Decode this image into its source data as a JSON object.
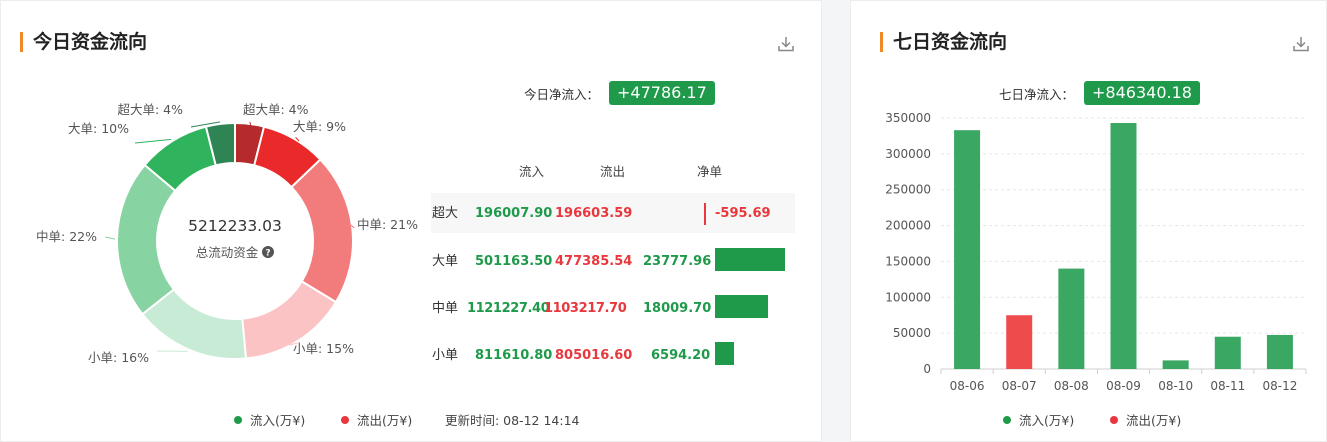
{
  "today": {
    "title": "今日资金流向",
    "net_label": "今日净流入：",
    "net_value": "+47786.17",
    "center_value": "5212233.03",
    "center_label": "总流动资金",
    "table_headers": {
      "inflow": "流入",
      "outflow": "流出",
      "net": "净单"
    },
    "rows": [
      {
        "cat": "超大",
        "inflow": "196007.90",
        "outflow": "196603.59",
        "net": "-595.69"
      },
      {
        "cat": "大单",
        "inflow": "501163.50",
        "outflow": "477385.54",
        "net": "23777.96"
      },
      {
        "cat": "中单",
        "inflow": "1121227.40",
        "outflow": "1103217.70",
        "net": "18009.70"
      },
      {
        "cat": "小单",
        "inflow": "811610.80",
        "outflow": "805016.60",
        "net": "6594.20"
      }
    ],
    "legend": {
      "inflow": "流入(万¥)",
      "outflow": "流出(万¥)"
    },
    "update_label": "更新时间: 08-12 14:14"
  },
  "week": {
    "title": "七日资金流向",
    "net_label": "七日净流入：",
    "net_value": "+846340.18",
    "legend": {
      "inflow": "流入(万¥)",
      "outflow": "流出(万¥)"
    }
  },
  "colors": {
    "green": "#1e9a4a",
    "red": "#e8383d",
    "accent": "#f08a24",
    "bar_green": "#3aa763",
    "bar_red": "#ee4c4c"
  },
  "chart_data": [
    {
      "type": "pie",
      "labels": [
        "超大单: 4%",
        "大单: 9%",
        "中单: 21%",
        "小单: 15%",
        "小单: 16%",
        "中单: 22%",
        "大单: 10%",
        "超大单: 4%"
      ],
      "values": [
        4,
        9,
        21,
        15,
        16,
        22,
        10,
        4
      ],
      "colors": [
        "#b52a2a",
        "#ea2a2a",
        "#f27c7c",
        "#fbc3c3",
        "#c8ebd6",
        "#88d3a2",
        "#2fb35c",
        "#2e8553"
      ]
    },
    {
      "type": "bar",
      "categories": [
        "08-06",
        "08-07",
        "08-08",
        "08-09",
        "08-10",
        "08-11",
        "08-12"
      ],
      "values": [
        333000,
        75000,
        140000,
        343000,
        12000,
        45000,
        47500
      ],
      "signs": [
        "in",
        "out",
        "in",
        "in",
        "in",
        "in",
        "in"
      ],
      "ylim": [
        0,
        350000
      ],
      "yticks": [
        0,
        50000,
        100000,
        150000,
        200000,
        250000,
        300000,
        350000
      ],
      "legend": [
        "流入(万¥)",
        "流出(万¥)"
      ]
    }
  ]
}
